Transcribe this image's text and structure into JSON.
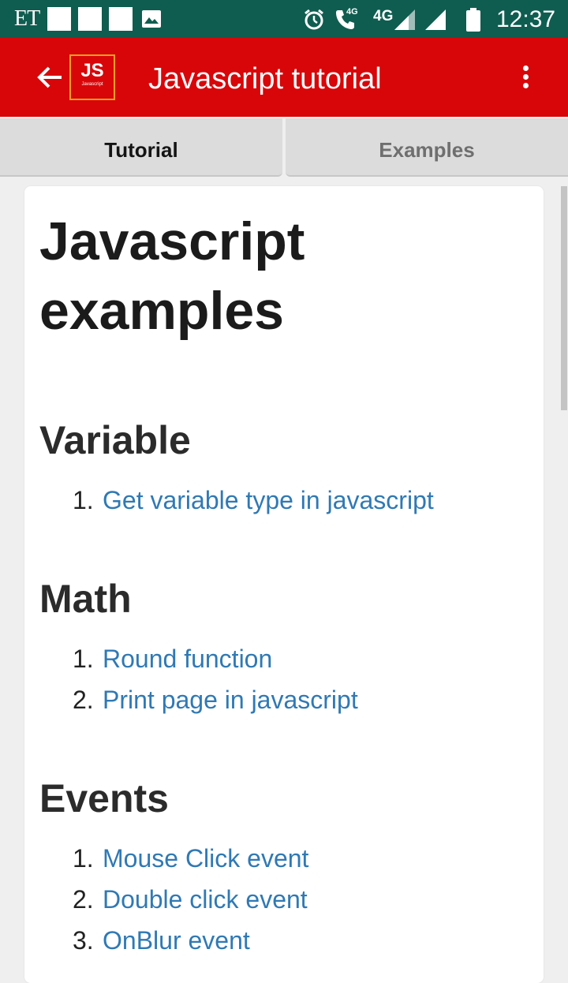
{
  "status_bar": {
    "carrier_label": "ET",
    "network_small": "4G",
    "network_large": "4G",
    "time": "12:37",
    "background_color": "#0f5d50"
  },
  "app_bar": {
    "logo_text": "JS",
    "logo_subtext": "Javascript",
    "title": "Javascript tutorial",
    "background_color": "#d90609"
  },
  "tabs": [
    {
      "label": "Tutorial",
      "selected": true
    },
    {
      "label": "Examples",
      "selected": false
    }
  ],
  "content": {
    "heading": "Javascript examples",
    "sections": [
      {
        "title": "Variable",
        "items": [
          {
            "num": "1.",
            "label": "Get variable type in javascript"
          }
        ]
      },
      {
        "title": "Math",
        "items": [
          {
            "num": "1.",
            "label": "Round function"
          },
          {
            "num": "2.",
            "label": "Print page in javascript"
          }
        ]
      },
      {
        "title": "Events",
        "items": [
          {
            "num": "1.",
            "label": "Mouse Click event"
          },
          {
            "num": "2.",
            "label": "Double click event"
          },
          {
            "num": "3.",
            "label": "OnBlur event"
          }
        ]
      }
    ],
    "link_color": "#2f79b5"
  }
}
